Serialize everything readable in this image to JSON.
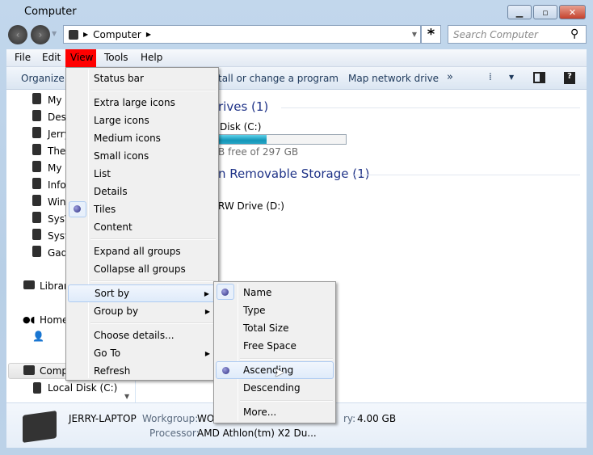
{
  "window": {
    "title": "Computer",
    "controls": [
      "minimize",
      "maximize",
      "close"
    ]
  },
  "address": {
    "crumbs": [
      "Computer"
    ],
    "search_placeholder": "Search Computer"
  },
  "menubar": {
    "items": [
      "File",
      "Edit",
      "View",
      "Tools",
      "Help"
    ],
    "active": "View",
    "active_color": "#ff0000"
  },
  "toolbar": {
    "organize": "Organize",
    "uninstall": "tall or change a program",
    "map_drive": "Map network drive",
    "more": "»"
  },
  "sidebar": {
    "items": [
      "My",
      "Desl",
      "Jerry",
      "The",
      "My",
      "Info",
      "Win",
      "SysV",
      "Syst",
      "Gad"
    ],
    "libraries": "Librar",
    "homegroup": "Home",
    "computer": "Comp",
    "local_disk": "Local Disk (C:)"
  },
  "main": {
    "hdd_header": "rives (1)",
    "disk_name": "Disk (C:)",
    "disk_free": "B free of 297 GB",
    "disk_used_percent": 42,
    "removable_header": "n Removable Storage (1)",
    "dvd": "RW Drive (D:)"
  },
  "details": {
    "name": "JERRY-LAPTOP",
    "workgroup_label": "Workgroup:",
    "workgroup_value": "WO",
    "memory_fragment": "ry:",
    "memory_value": "4.00 GB",
    "processor_label": "Processor:",
    "processor_value": "AMD Athlon(tm) X2 Du..."
  },
  "view_menu": {
    "items": [
      "Status bar",
      "Extra large icons",
      "Large icons",
      "Medium icons",
      "Small icons",
      "List",
      "Details",
      "Tiles",
      "Content",
      "Expand all groups",
      "Collapse all groups",
      "Sort by",
      "Group by",
      "Choose details...",
      "Go To",
      "Refresh"
    ],
    "checked": "Tiles",
    "highlighted": "Sort by"
  },
  "sort_menu": {
    "items": [
      "Name",
      "Type",
      "Total Size",
      "Free Space",
      "Ascending",
      "Descending",
      "More..."
    ],
    "checked": [
      "Name",
      "Ascending"
    ],
    "highlighted": "Ascending"
  }
}
